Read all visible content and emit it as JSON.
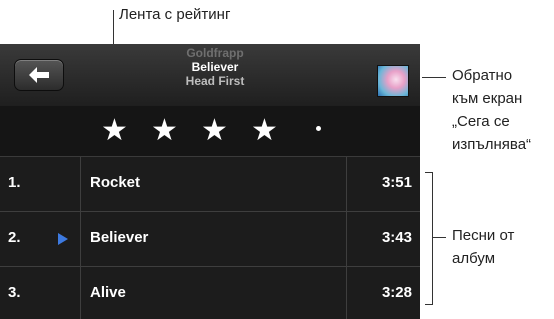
{
  "callouts": {
    "rating": "Лента с рейтинг",
    "back_to_now_playing": [
      "Обратно",
      "към екран",
      "„Сега се",
      "изпълнява“"
    ],
    "album_songs": [
      "Песни от",
      "албум"
    ]
  },
  "header": {
    "back_icon": "left-arrow-icon",
    "artist": "Goldfrapp",
    "song": "Believer",
    "album": "Head First"
  },
  "rating": {
    "stars": 4,
    "max": 5
  },
  "tracks": [
    {
      "number": "1.",
      "title": "Rocket",
      "time": "3:51",
      "playing": false
    },
    {
      "number": "2.",
      "title": "Believer",
      "time": "3:43",
      "playing": true
    },
    {
      "number": "3.",
      "title": "Alive",
      "time": "3:28",
      "playing": false
    }
  ],
  "colors": {
    "play_indicator": "#3d7ae0"
  }
}
